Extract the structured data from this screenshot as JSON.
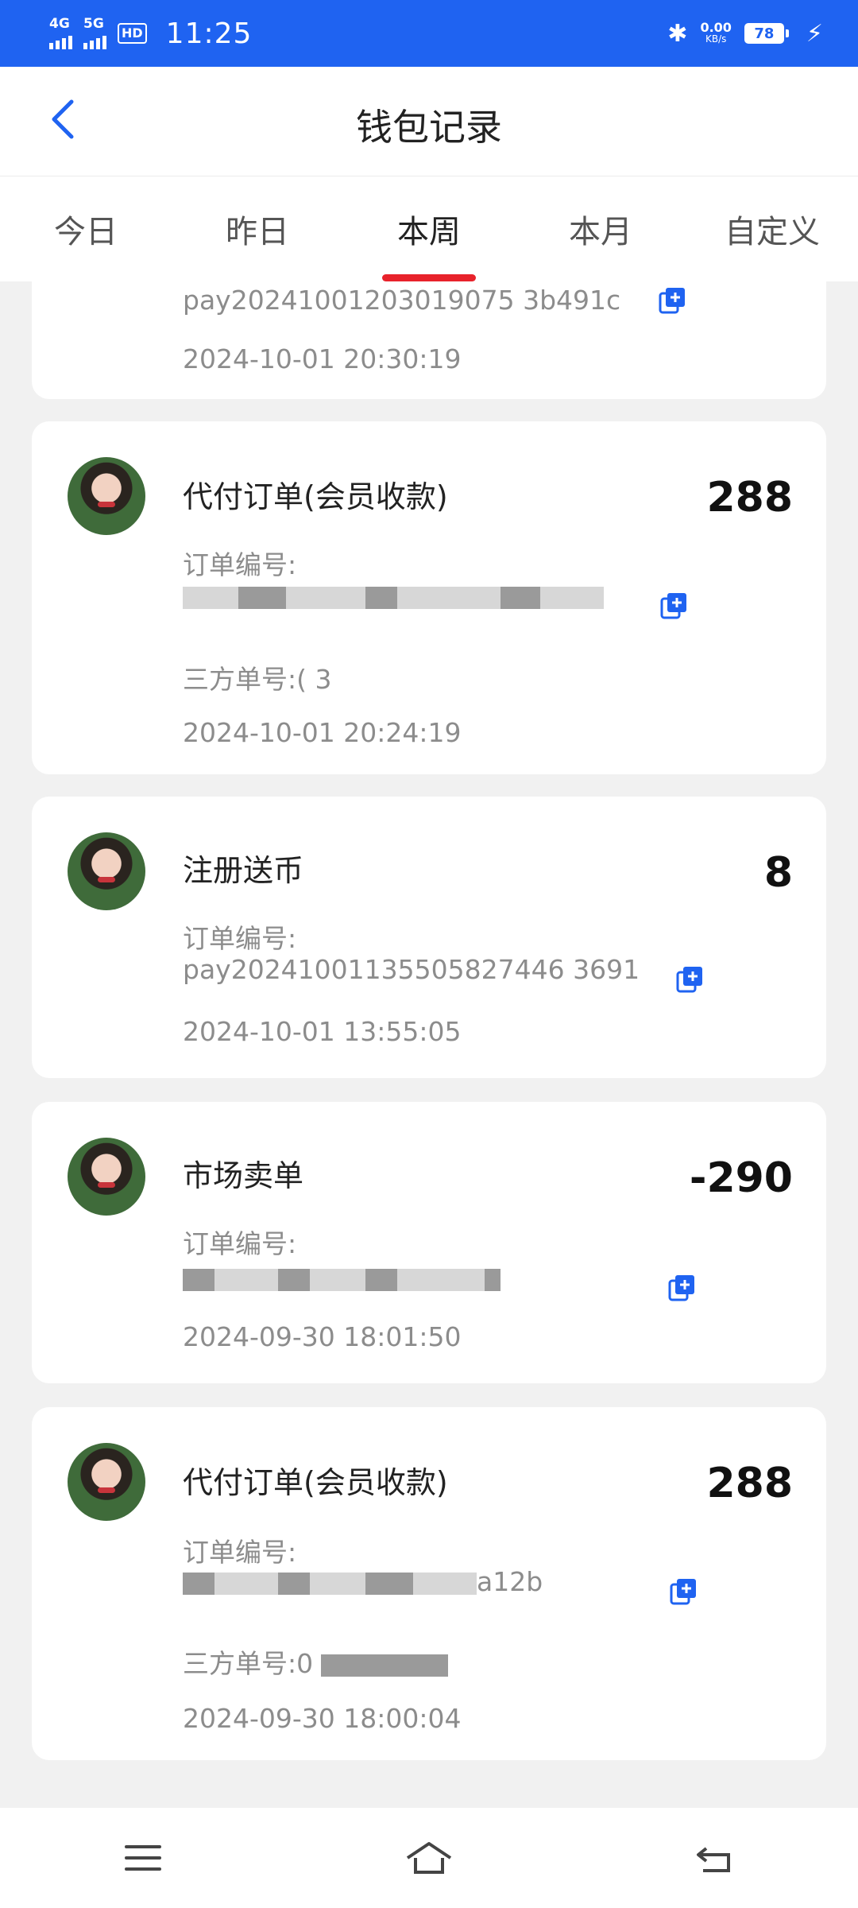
{
  "status_bar": {
    "net1": "4G",
    "net2": "5G",
    "hd": "HD",
    "time": "11:25",
    "speed_value": "0.00",
    "speed_unit": "KB/s",
    "battery": "78"
  },
  "header": {
    "title": "钱包记录"
  },
  "tabs": [
    {
      "label": "今日"
    },
    {
      "label": "昨日"
    },
    {
      "label": "本周",
      "active": true
    },
    {
      "label": "本月"
    },
    {
      "label": "自定义"
    }
  ],
  "records": [
    {
      "order_value": "pay20241001203019075 3b491c",
      "date": "2024-10-01 20:30:19"
    },
    {
      "title": "代付订单(会员收款)",
      "amount": "288",
      "order_label": "订单编号:",
      "third_label": "三方单号:",
      "third_value_visible": "(            3",
      "date": "2024-10-01 20:24:19"
    },
    {
      "title": "注册送币",
      "amount": "8",
      "order_label": "订单编号:",
      "order_value": "pay20241001135505827446 3691",
      "date": "2024-10-01 13:55:05"
    },
    {
      "title": "市场卖单",
      "amount": "-290",
      "order_label": "订单编号:",
      "date": "2024-09-30 18:01:50"
    },
    {
      "title": "代付订单(会员收款)",
      "amount": "288",
      "order_label": "订单编号:",
      "order_value_visible": "a12b",
      "third_label": "三方单号:",
      "third_value_visible": "0",
      "date": "2024-09-30 18:00:04"
    }
  ],
  "icons": {
    "back": "chevron-left-icon",
    "copy": "copy-icon",
    "menu": "menu-icon",
    "home": "home-icon",
    "return": "back-icon"
  },
  "colors": {
    "status_bar": "#1f63f1",
    "accent_blue": "#1f63f1",
    "tab_indicator": "#e8222b"
  }
}
